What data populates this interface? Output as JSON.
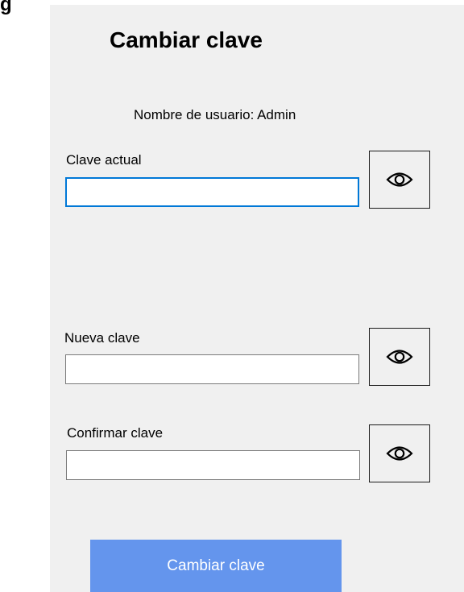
{
  "window": {
    "corner_fragment": "g"
  },
  "dialog": {
    "title": "Cambiar clave",
    "user_line": "Nombre de usuario: Admin",
    "fields": [
      {
        "label": "Clave actual",
        "value": ""
      },
      {
        "label": "Nueva clave",
        "value": ""
      },
      {
        "label": "Confirmar clave",
        "value": ""
      }
    ],
    "eye_icon": "eye-icon",
    "submit_label": "Cambiar clave"
  },
  "colors": {
    "dialog_background": "#f0f0f0",
    "focus_border": "#0078d7",
    "submit_background": "#6495ed",
    "submit_text": "#ffffff"
  }
}
